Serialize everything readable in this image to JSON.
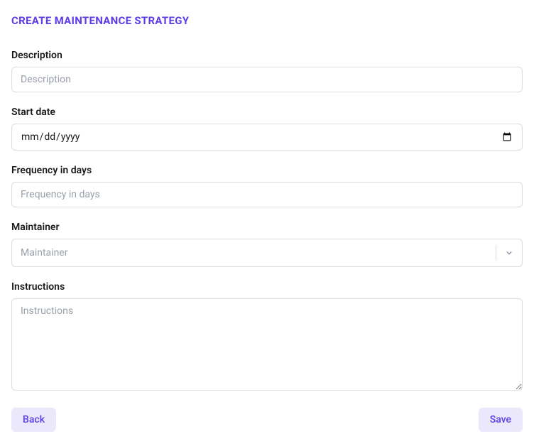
{
  "header": {
    "title": "CREATE MAINTENANCE STRATEGY"
  },
  "fields": {
    "description": {
      "label": "Description",
      "placeholder": "Description",
      "value": ""
    },
    "startDate": {
      "label": "Start date",
      "placeholder": "mm/dd/yyyy",
      "value": ""
    },
    "frequency": {
      "label": "Frequency in days",
      "placeholder": "Frequency in days",
      "value": ""
    },
    "maintainer": {
      "label": "Maintainer",
      "placeholder": "Maintainer",
      "value": ""
    },
    "instructions": {
      "label": "Instructions",
      "placeholder": "Instructions",
      "value": ""
    }
  },
  "buttons": {
    "back": "Back",
    "save": "Save"
  }
}
